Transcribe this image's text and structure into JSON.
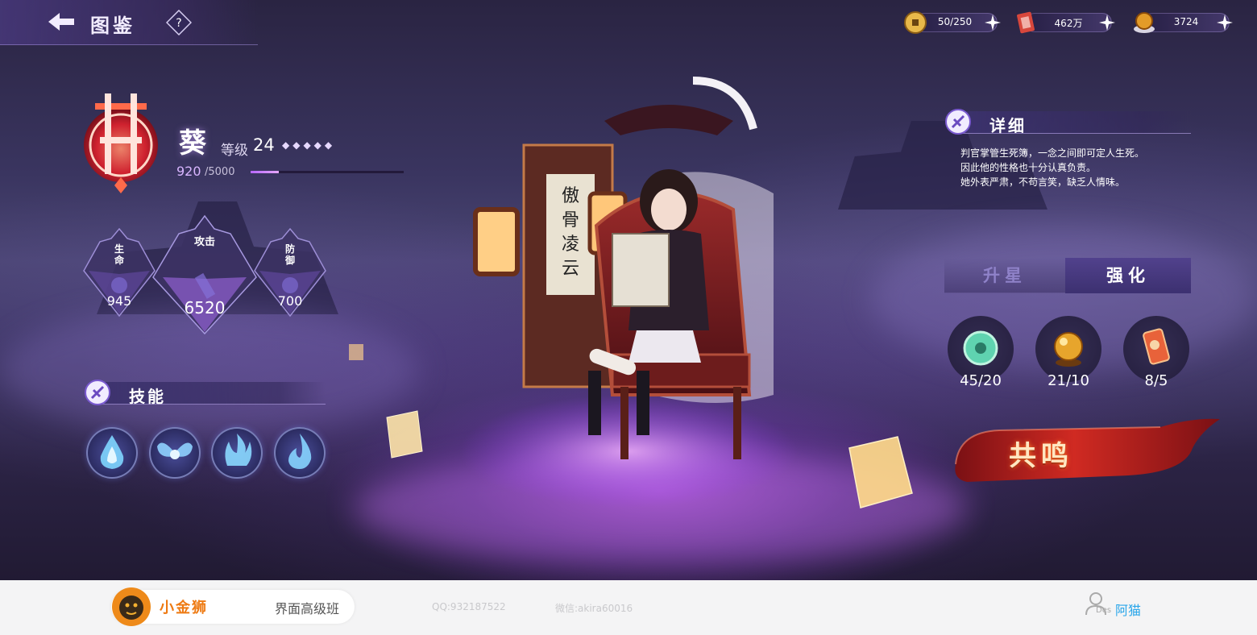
{
  "header": {
    "title": "图鉴",
    "back_icon": "back-arrow-icon",
    "help_label": "?"
  },
  "resources": [
    {
      "name": "coin",
      "icon": "copper-coin-icon",
      "value": "50/250"
    },
    {
      "name": "ticket",
      "icon": "red-ticket-icon",
      "value": "462万"
    },
    {
      "name": "orb",
      "icon": "golden-orb-icon",
      "value": "3724"
    }
  ],
  "character": {
    "name": "葵",
    "level_label": "等级",
    "level": "24",
    "stars": "◆◆◆◆◆",
    "exp_current": "920",
    "exp_max": "/5000",
    "exp_progress": 0.184
  },
  "stats": {
    "hp": {
      "label": "生命",
      "value": "945"
    },
    "atk": {
      "label": "攻击",
      "value": "6520"
    },
    "def": {
      "label": "防御",
      "value": "700"
    }
  },
  "skills": {
    "title": "技能",
    "items": [
      {
        "icon": "blue-flame-skill-icon"
      },
      {
        "icon": "butterfly-flame-skill-icon"
      },
      {
        "icon": "triple-flame-skill-icon"
      },
      {
        "icon": "swirl-flame-skill-icon"
      }
    ]
  },
  "detail": {
    "title": "详细",
    "lines": [
      "判官掌管生死簿，一念之间即可定人生死。",
      "因此他的性格也十分认真负责。",
      "她外表严肃，不苟言笑，缺乏人情味。"
    ]
  },
  "tabs": {
    "star_up": "升星",
    "enhance": "强化",
    "active": "enhance"
  },
  "materials": [
    {
      "icon": "jade-disc-icon",
      "count": "45/20"
    },
    {
      "icon": "golden-orb-icon",
      "count": "21/10"
    },
    {
      "icon": "talisman-icon",
      "count": "8/5"
    }
  ],
  "resonance_label": "共鸣",
  "footer": {
    "brand": "小金狮",
    "course": "界面高级班",
    "qq": "QQ:932187522",
    "wechat": "微信:akira60016",
    "user_des": "Des",
    "user_name": "阿猫"
  },
  "colors": {
    "accent": "#b667ff",
    "panel": "#3a2f6a",
    "resonance": "#c2281e",
    "brand": "#ee7a12",
    "link": "#2aa6ea"
  }
}
